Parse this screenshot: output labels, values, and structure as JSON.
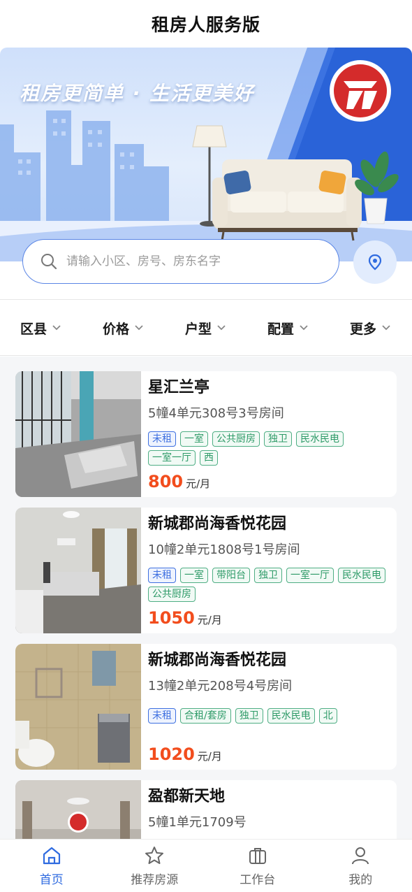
{
  "header": {
    "title": "租房人服务版"
  },
  "banner": {
    "slogan": "租房更简单 · 生活更美好",
    "logo_icon": "company-logo-icon"
  },
  "search": {
    "placeholder": "请输入小区、房号、房东名字",
    "location_icon": "location-pin-icon"
  },
  "filters": [
    {
      "label": "区县"
    },
    {
      "label": "价格"
    },
    {
      "label": "户型"
    },
    {
      "label": "配置"
    },
    {
      "label": "更多"
    }
  ],
  "listings": [
    {
      "name": "星汇兰亭",
      "address": "5幢4单元308号3号房间",
      "status": "未租",
      "tags": [
        "一室",
        "公共厨房",
        "独卫",
        "民水民电",
        "一室一厅",
        "西"
      ],
      "price": "800",
      "unit": "元/月"
    },
    {
      "name": "新城郡尚海香悦花园",
      "address": "10幢2单元1808号1号房间",
      "status": "未租",
      "tags": [
        "一室",
        "带阳台",
        "独卫",
        "一室一厅",
        "民水民电",
        "公共厨房"
      ],
      "price": "1050",
      "unit": "元/月"
    },
    {
      "name": "新城郡尚海香悦花园",
      "address": "13幢2单元208号4号房间",
      "status": "未租",
      "tags": [
        "合租/套房",
        "独卫",
        "民水民电",
        "北"
      ],
      "price": "1020",
      "unit": "元/月"
    },
    {
      "name": "盈都新天地",
      "address": "5幢1单元1709号",
      "status": "",
      "tags": [],
      "price": "",
      "unit": ""
    }
  ],
  "tabbar": [
    {
      "label": "首页",
      "icon": "home-icon",
      "active": true
    },
    {
      "label": "推荐房源",
      "icon": "star-icon",
      "active": false
    },
    {
      "label": "工作台",
      "icon": "briefcase-icon",
      "active": false
    },
    {
      "label": "我的",
      "icon": "user-icon",
      "active": false
    }
  ],
  "colors": {
    "accent": "#2f6be0",
    "price": "#f24d1d",
    "tag_green": "#2d9a67",
    "tag_blue": "#3d6fe0"
  }
}
